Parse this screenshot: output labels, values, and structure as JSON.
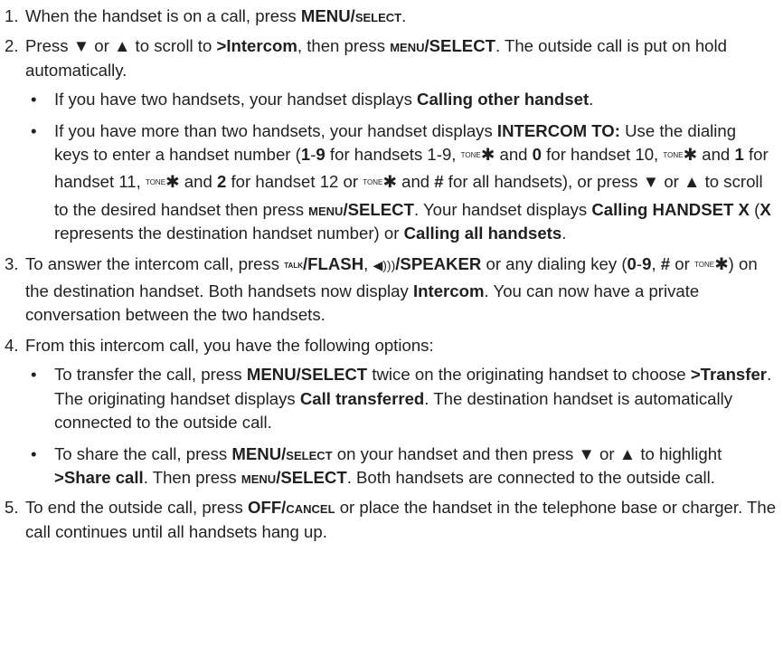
{
  "steps": [
    {
      "num": "1."
    },
    {
      "num": "2."
    },
    {
      "num": "3."
    },
    {
      "num": "4."
    },
    {
      "num": "5."
    }
  ],
  "bullet_char": "•",
  "text": {
    "s1a": "When the handset is on a call, press ",
    "s1b": "MENU/",
    "s1c": "select",
    "s1d": ".",
    "s2a": "Press ",
    "s2b": "▼",
    "s2c": " or ",
    "s2d": "▲",
    "s2e": " to scroll to ",
    "s2f": ">Intercom",
    "s2g": ", then press ",
    "s2h": "menu",
    "s2i": "/SELECT",
    "s2j": ". The outside call is put on hold automatically.",
    "b1a": "If you have two handsets, your handset displays ",
    "b1b": "Calling other handset",
    "b1c": ".",
    "b2a": "If you have more than two handsets, your handset displays ",
    "b2b": "INTERCOM TO:",
    "b2c": " Use the dialing keys to enter a handset number (",
    "b2d": "1",
    "b2e": "-",
    "b2f": "9",
    "b2g": " for handsets 1-9, ",
    "tone": "TONE",
    "star": "✱",
    "b2h": " and ",
    "b2i": "0",
    "b2j": " for handset 10, ",
    "b2k": " and ",
    "b2l": "1",
    "b2m": " for handset 11, ",
    "b2n": " and ",
    "b2o": "2",
    "b2p": " for handset 12 or ",
    "b2q": " and ",
    "b2r": "#",
    "b2s": " for all handsets), or press ",
    "b2t": "▼",
    "b2u": " or ",
    "b2v": "▲",
    "b2w": " to scroll to the desired handset then press ",
    "b2x": "menu",
    "b2y": "/SELECT",
    "b2z": ". Your handset displays ",
    "b2aa": "Calling HANDSET X",
    "b2ab": " (",
    "b2ac": "X",
    "b2ad": " represents the destination handset number) or ",
    "b2ae": "Calling all handsets",
    "b2af": ".",
    "s3a": "To answer the intercom call, press ",
    "talk": "TALK",
    "s3b": "/FLASH",
    "s3c": ", ",
    "speaker_icon": "◀)))",
    "s3d": "/SPEAKER",
    "s3e": " or any dialing key (",
    "s3f": "0",
    "s3g": "-",
    "s3h": "9",
    "s3i": ", ",
    "s3j": "#",
    "s3k": " or ",
    "s3l": ") on the destination handset. Both handsets now display ",
    "s3m": "Intercom",
    "s3n": ". You can now have a private conversation between the two handsets.",
    "s4a": "From this intercom call, you have the following options:",
    "b3a": "To transfer the call, press ",
    "b3b": "MENU/SELECT",
    "b3c": " twice on the originating handset to choose ",
    "b3d": ">Transfer",
    "b3e": ". The originating handset displays ",
    "b3f": "Call transferred",
    "b3g": ". The destination handset is automatically connected to the outside call.",
    "b4a": "To share the call, press ",
    "b4b": "MENU/",
    "b4c": "select",
    "b4d": " on your handset and then press ",
    "b4e": "▼",
    "b4f": " or ",
    "b4g": "▲",
    "b4h": " to highlight ",
    "b4i": ">Share call",
    "b4j": ". Then press ",
    "b4k": "menu",
    "b4l": "/SELECT",
    "b4m": ". Both handsets are connected to the outside call.",
    "s5a": "To end the outside call, press ",
    "s5b": "OFF/",
    "s5c": "cancel",
    "s5d": " or place the handset in the telephone base or charger. The call continues until all handsets hang up."
  }
}
